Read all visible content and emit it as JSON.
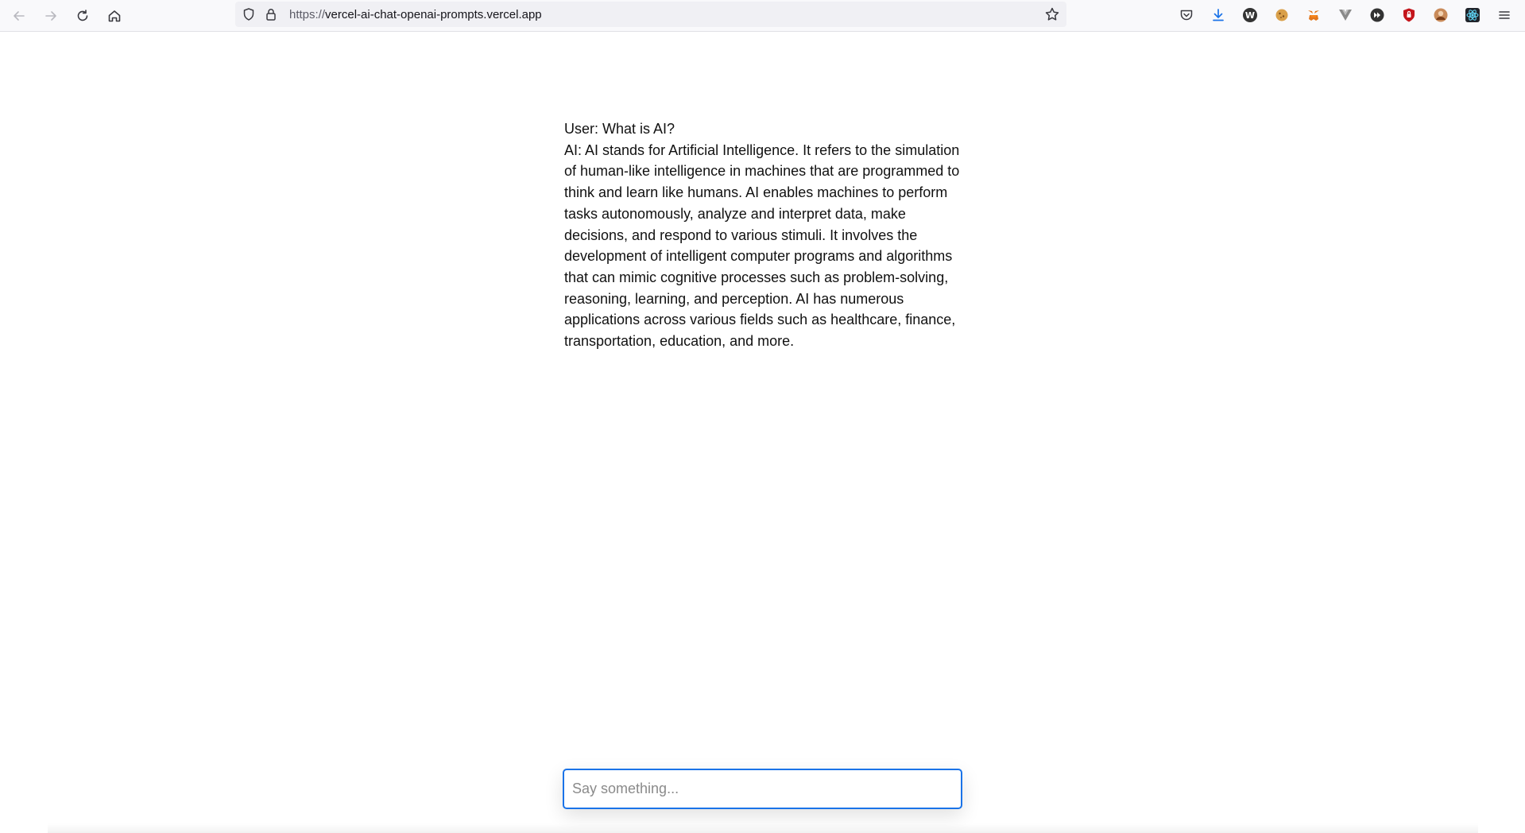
{
  "browser": {
    "url_protocol": "https://",
    "url_host": "vercel-ai-chat-openai-prompts.vercel.app",
    "icons": {
      "back": "arrow-left-icon",
      "forward": "arrow-right-icon",
      "reload": "reload-icon",
      "home": "home-icon",
      "shield": "shield-icon",
      "lock": "lock-icon",
      "bookmark": "star-icon",
      "pocket": "pocket-icon",
      "downloads": "download-icon",
      "menu": "hamburger-menu-icon"
    },
    "extensions": [
      {
        "name": "wikipedia-extension-icon",
        "glyph": "W",
        "color": "#333333"
      },
      {
        "name": "cookie-extension-icon",
        "glyph": "",
        "color": "#d9a04a"
      },
      {
        "name": "metamask-extension-icon",
        "glyph": "",
        "color": "#e2761b"
      },
      {
        "name": "vue-devtools-extension-icon",
        "glyph": "",
        "color": "#8a8a8a"
      },
      {
        "name": "media-extension-icon",
        "glyph": "",
        "color": "#333333"
      },
      {
        "name": "ublock-extension-icon",
        "glyph": "",
        "color": "#c4161c"
      },
      {
        "name": "avatar-extension-icon",
        "glyph": "",
        "color": "#a0522d"
      },
      {
        "name": "react-devtools-extension-icon",
        "glyph": "",
        "color": "#20232a"
      }
    ],
    "accent_color": "#1a73e8"
  },
  "chat": {
    "messages": [
      {
        "role": "user",
        "text": "User: What is AI?"
      },
      {
        "role": "assistant",
        "text": "AI: AI stands for Artificial Intelligence. It refers to the simulation of human-like intelligence in machines that are programmed to think and learn like humans. AI enables machines to perform tasks autonomously, analyze and interpret data, make decisions, and respond to various stimuli. It involves the development of intelligent computer programs and algorithms that can mimic cognitive processes such as problem-solving, reasoning, learning, and perception. AI has numerous applications across various fields such as healthcare, finance, transportation, education, and more."
      }
    ],
    "input": {
      "value": "",
      "placeholder": "Say something..."
    }
  }
}
